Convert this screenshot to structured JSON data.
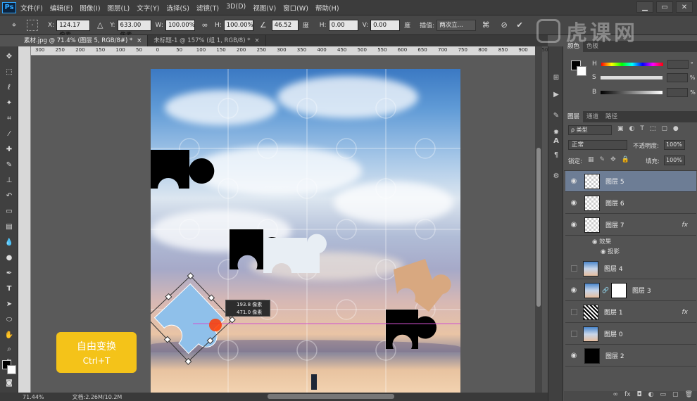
{
  "app": {
    "logo": "Ps"
  },
  "menu": [
    "文件(F)",
    "编辑(E)",
    "图像(I)",
    "图层(L)",
    "文字(Y)",
    "选择(S)",
    "滤镜(T)",
    "3D(D)",
    "视图(V)",
    "窗口(W)",
    "帮助(H)"
  ],
  "window_controls": [
    "▁",
    "▭",
    "✕"
  ],
  "options": {
    "x_label": "X:",
    "x_value": "124.17 像素",
    "y_label": "Y:",
    "y_value": "633.00 像素",
    "w_label": "W:",
    "w_value": "100.00%",
    "h_label": "H:",
    "h_value": "100.00%",
    "angle_value": "46.52",
    "angle_unit": "度",
    "hskew_label": "H:",
    "hskew_value": "0.00",
    "vskew_label": "V:",
    "vskew_value": "0.00",
    "skew_unit": "度",
    "interp_label": "插值:",
    "interp_value": "两次立..."
  },
  "tabs": [
    {
      "label": "素材.jpg @ 71.4% (图层 5, RGB/8#) *",
      "close": "×"
    },
    {
      "label": "未标题-1 @ 157% (组 1, RGB/8) *",
      "close": "×"
    }
  ],
  "ruler_ticks": [
    "300",
    "250",
    "200",
    "150",
    "100",
    "50",
    "0",
    "50",
    "100",
    "150",
    "200",
    "250",
    "300",
    "350",
    "400",
    "450",
    "500",
    "550",
    "600",
    "650",
    "700",
    "750",
    "800",
    "850",
    "900",
    "950"
  ],
  "tooltip": {
    "line1": "193.8 像素",
    "line2": "471.0 像素"
  },
  "badge": {
    "title": "自由变换",
    "shortcut": "Ctrl+T"
  },
  "status": {
    "zoom": "71.44%",
    "doc": "文档:2.26M/10.2M"
  },
  "watermark": "虎课网",
  "color_panel": {
    "tabs": [
      "颜色",
      "色板"
    ],
    "rows": [
      {
        "label": "H",
        "pct": "°"
      },
      {
        "label": "S",
        "pct": "%"
      },
      {
        "label": "B",
        "pct": "%"
      }
    ]
  },
  "layers_panel": {
    "tabs": [
      "图层",
      "通道",
      "路径"
    ],
    "filter": "ρ 类型",
    "blend": "正常",
    "opacity_label": "不透明度:",
    "opacity_value": "100%",
    "lock_label": "锁定:",
    "fill_label": "填充:",
    "fill_value": "100%",
    "layers": [
      {
        "name": "图层 5",
        "visible": true,
        "selected": true,
        "fx": ""
      },
      {
        "name": "图层 6",
        "visible": true,
        "selected": false,
        "fx": ""
      },
      {
        "name": "图层 7",
        "visible": true,
        "selected": false,
        "fx": "fx"
      },
      {
        "name": "图层 4",
        "visible": false,
        "selected": false,
        "fx": ""
      },
      {
        "name": "图层 3",
        "visible": true,
        "selected": false,
        "fx": ""
      },
      {
        "name": "图层 1",
        "visible": false,
        "selected": false,
        "fx": "fx"
      },
      {
        "name": "图层 0",
        "visible": false,
        "selected": false,
        "fx": ""
      },
      {
        "name": "图层 2",
        "visible": true,
        "selected": false,
        "fx": ""
      }
    ],
    "effects_label": "效果",
    "shadow_label": "投影"
  },
  "icons": {
    "eye": "eye-icon",
    "link": "link-icon",
    "fx": "fx-badge"
  }
}
